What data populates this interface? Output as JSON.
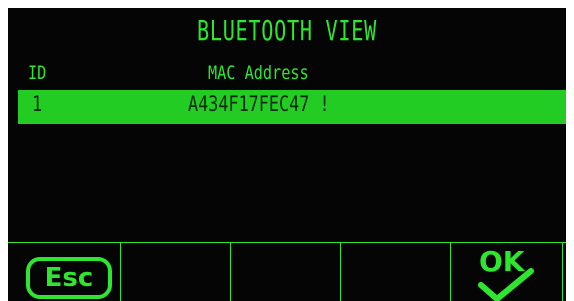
{
  "screen": {
    "title": "BLUETOOTH VIEW",
    "columns": {
      "id": "ID",
      "mac": "MAC Address"
    },
    "rows": [
      {
        "id": "1",
        "mac": "A434F17FEC47 !"
      }
    ]
  },
  "softkeys": {
    "esc_label": "Esc",
    "ok_label": "OK"
  },
  "icons": {
    "ok": "check-icon"
  },
  "colors": {
    "text": "#2fe62f",
    "highlight": "#22cc22",
    "background": "#050505"
  }
}
